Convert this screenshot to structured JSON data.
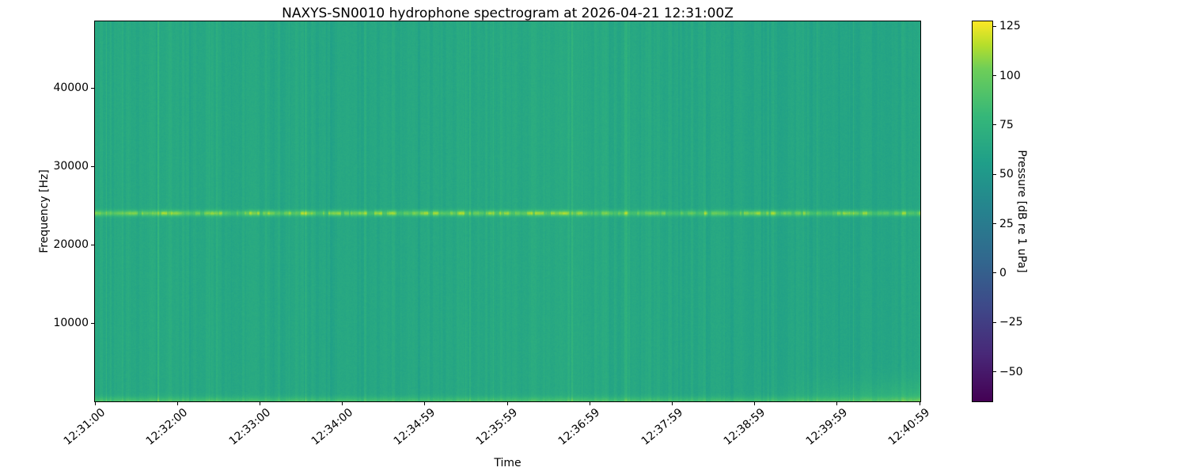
{
  "chart_data": {
    "type": "heatmap",
    "subtype": "spectrogram",
    "title": "NAXYS-SN0010 hydrophone spectrogram at 2026-04-21 12:31:00Z",
    "xlabel": "Time",
    "ylabel": "Frequency [Hz]",
    "x_ticks": [
      "12:31:00",
      "12:32:00",
      "12:33:00",
      "12:34:00",
      "12:34:59",
      "12:35:59",
      "12:36:59",
      "12:37:59",
      "12:38:59",
      "12:39:59",
      "12:40:59"
    ],
    "y_ticks": [
      {
        "label": "10000",
        "value": 10000
      },
      {
        "label": "20000",
        "value": 20000
      },
      {
        "label": "30000",
        "value": 30000
      },
      {
        "label": "40000",
        "value": 40000
      }
    ],
    "freq_range_hz": [
      0,
      48485
    ],
    "grid": false,
    "legend": "none",
    "colormap": "viridis",
    "colorbar": {
      "label": "Pressure [dB re 1 uPa]",
      "vmin": -65,
      "vmax": 127.5,
      "ticks": [
        {
          "label": "125",
          "value": 125
        },
        {
          "label": "100",
          "value": 100
        },
        {
          "label": "75",
          "value": 75
        },
        {
          "label": "50",
          "value": 50
        },
        {
          "label": "25",
          "value": 25
        },
        {
          "label": "0",
          "value": 0
        },
        {
          "label": "−25",
          "value": -25
        },
        {
          "label": "−50",
          "value": -50
        }
      ]
    },
    "features": [
      {
        "name": "broadband-background",
        "level_db": 64,
        "description": "diffuse green background across 0–48.5 kHz with vertical broadband transient striping of roughly ±10 dB"
      },
      {
        "name": "narrowband-tone",
        "frequency_hz": 24000,
        "level_db": 98,
        "description": "continuous bright tonal line at ~24 kHz across the entire record, intensity fluctuating in time"
      },
      {
        "name": "low-frequency-noise",
        "frequency_hz_below": 1500,
        "level_db": 86,
        "description": "bright band hugging the bottom (0 Hz) edge for the whole record"
      },
      {
        "name": "late-low-frequency-rise",
        "time_from": "12:38:45",
        "frequency_hz_below": 4000,
        "level_db": 96,
        "description": "elevated low-frequency energy during the final ~2 minutes (bottom-right brightening)"
      }
    ],
    "render": {
      "seed": 1337,
      "base_db": 64,
      "stripe_sigma": 4.6,
      "stripe_max_width": 4,
      "bright_col_prob": 0.05,
      "bright_col_min": 4,
      "bright_col_extra": 8,
      "tone_hz": 24000,
      "tone_sigma_hz": 260,
      "tone_amp_db": 38,
      "low_amp_db": 23,
      "low_sigma_hz": 550,
      "tail_start_frac": 0.79,
      "tail_amp_db": 14,
      "tail_sigma_hz": 2600,
      "pixel_noise_db": 5
    }
  }
}
